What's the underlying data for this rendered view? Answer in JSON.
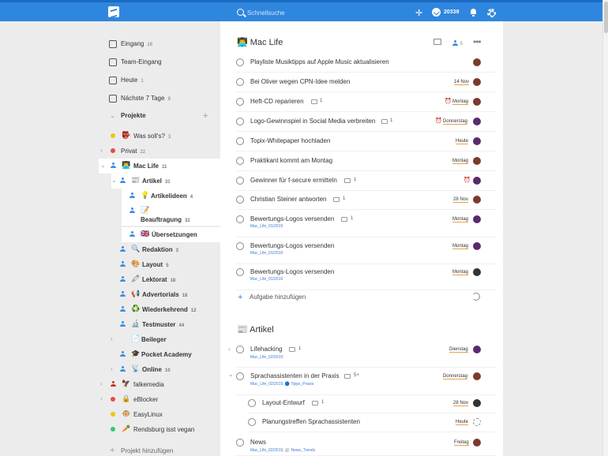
{
  "topbar": {
    "search_placeholder": "Schnellsuche",
    "karma": "20339"
  },
  "sidebar": {
    "inbox": {
      "label": "Eingang",
      "count": "16"
    },
    "team_inbox": {
      "label": "Team-Eingang"
    },
    "today": {
      "label": "Heute",
      "count": "1"
    },
    "next7": {
      "label": "Nächste 7 Tage",
      "count": "9"
    },
    "projects_label": "Projekte",
    "add_project": "Projekt hinzufügen",
    "projects": [
      {
        "emoji": "👺",
        "name": "Was soll's?",
        "count": "3"
      },
      {
        "emoji": "",
        "name": "Privat",
        "count": "22"
      },
      {
        "emoji": "👨‍💻",
        "name": "Mac Life",
        "count": "11"
      },
      {
        "emoji": "📰",
        "name": "Artikel",
        "count": "31"
      },
      {
        "emoji": "💡",
        "name": "Artikelideen",
        "count": "4"
      },
      {
        "emoji": "📝",
        "name": "Beauftragung",
        "count": "32"
      },
      {
        "emoji": "🇬🇧",
        "name": "Übersetzungen",
        "count": ""
      },
      {
        "emoji": "🔍",
        "name": "Redaktion",
        "count": "3"
      },
      {
        "emoji": "🎨",
        "name": "Layout",
        "count": "5"
      },
      {
        "emoji": "🖍",
        "name": "Lektorat",
        "count": "18"
      },
      {
        "emoji": "📢",
        "name": "Advertorials",
        "count": "18"
      },
      {
        "emoji": "♻️",
        "name": "Wiederkehrend",
        "count": "12"
      },
      {
        "emoji": "🔬",
        "name": "Testmuster",
        "count": "44"
      },
      {
        "emoji": "📄",
        "name": "Beileger",
        "count": ""
      },
      {
        "emoji": "🎓",
        "name": "Pocket Academy",
        "count": ""
      },
      {
        "emoji": "📡",
        "name": "Online",
        "count": "10"
      },
      {
        "emoji": "🦅",
        "name": "falkemedia",
        "count": ""
      },
      {
        "emoji": "🔒",
        "name": "eBlocker",
        "count": ""
      },
      {
        "emoji": "🐵",
        "name": "EasyLinux",
        "count": ""
      },
      {
        "emoji": "🥕",
        "name": "Rendsburg isst vegan",
        "count": ""
      }
    ]
  },
  "main": {
    "section1": {
      "emoji": "👨‍💻",
      "title": "Mac Life",
      "members": "5"
    },
    "section2": {
      "emoji": "📰",
      "title": "Artikel"
    },
    "add_task": "Aufgabe hinzufügen",
    "tasks1": [
      {
        "name": "Playliste Musiktipps auf Apple Music aktualisieren",
        "comments": "",
        "due": "",
        "sub": ""
      },
      {
        "name": "Bei Oliver wegen CPN-Idee melden",
        "comments": "",
        "due": "14 Nov",
        "sub": ""
      },
      {
        "name": "Heft-CD reparieren",
        "comments": "1",
        "due": "Montag",
        "sub": ""
      },
      {
        "name": "Logo-Gewinnspiel in Social Media verbreiten",
        "comments": "1",
        "due": "Donnerstag",
        "sub": ""
      },
      {
        "name": "Topix-Whitepaper hochladen",
        "comments": "",
        "due": "Heute",
        "sub": ""
      },
      {
        "name": "Praktikant kommt am Montag",
        "comments": "",
        "due": "Montag",
        "sub": ""
      },
      {
        "name": "Gewinner für f-secure ermitteln",
        "comments": "1",
        "due": "",
        "sub": ""
      },
      {
        "name": "Christian Steiner antworten",
        "comments": "1",
        "due": "28 Nov",
        "sub": ""
      },
      {
        "name": "Bewertungs-Logos versenden",
        "comments": "1",
        "due": "Montag",
        "sub": "Mac_Life_01/2019"
      },
      {
        "name": "Bewertungs-Logos versenden",
        "comments": "",
        "due": "Montag",
        "sub": "Mac_Life_01/2019"
      },
      {
        "name": "Bewertungs-Logos versenden",
        "comments": "",
        "due": "Montag",
        "sub": "Mac_Life_01/2019"
      }
    ],
    "tasks2": [
      {
        "name": "Lifehacking",
        "comments": "1",
        "due": "Dienstag",
        "sub": "Mac_Life_02/2019"
      },
      {
        "name": "Sprachassistenten in der Praxis",
        "comments": "5+",
        "due": "Donnerstag",
        "sub": "Mac_Life_02/2019, 🔵 Tipps_Praxis"
      },
      {
        "name": "Layout-Entwurf",
        "comments": "1",
        "due": "28 Nov",
        "sub": ""
      },
      {
        "name": "Planungstreffen Sprachassistenten",
        "comments": "",
        "due": "Heute",
        "sub": ""
      },
      {
        "name": "News",
        "comments": "",
        "due": "Freitag",
        "sub": "Mac_Life_02/2019, 📰 News_Trends"
      }
    ]
  }
}
